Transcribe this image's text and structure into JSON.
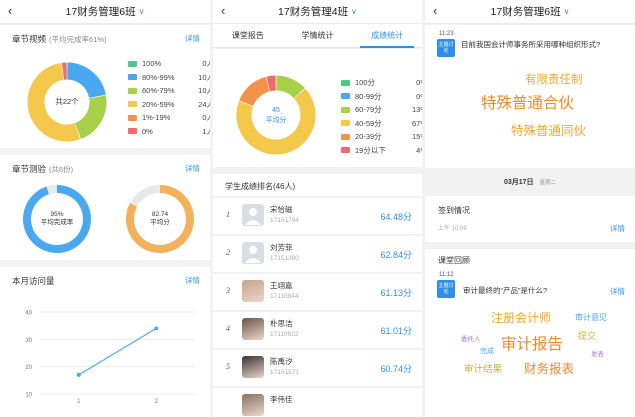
{
  "panel1": {
    "title": "17财务管理6班",
    "video": {
      "title": "章节视频",
      "subtitle": "(平均完成率61%)",
      "detail": "详情",
      "donut_center": "共22个",
      "legend": [
        {
          "label": "100%",
          "count": "0人",
          "color": "#4cc98a",
          "value": 0
        },
        {
          "label": "80%-99%",
          "count": "10人",
          "color": "#4aa8f0",
          "value": 10
        },
        {
          "label": "60%-79%",
          "count": "10人",
          "color": "#a9d04a",
          "value": 10
        },
        {
          "label": "20%-59%",
          "count": "24人",
          "color": "#f3c84b",
          "value": 24
        },
        {
          "label": "1%-19%",
          "count": "0人",
          "color": "#f5924a",
          "value": 0
        },
        {
          "label": "0%",
          "count": "1人",
          "color": "#ef6a6a",
          "value": 1
        }
      ]
    },
    "test": {
      "title": "章节测验",
      "subtitle": "(共6份)",
      "detail": "详情",
      "ring1_value": "95%",
      "ring1_label": "平均完成率",
      "ring1_pct": 95,
      "ring2_value": "82.74",
      "ring2_label": "平均分",
      "ring2_pct": 82.74
    },
    "visits": {
      "title": "本月访问量",
      "detail": "详情"
    }
  },
  "panel2": {
    "title": "17财务管理4班",
    "tabs": [
      "课堂报告",
      "学情统计",
      "成绩统计"
    ],
    "donut_center_value": "45",
    "donut_center_label": "平均分",
    "legend": [
      {
        "label": "100分",
        "pct": "0%",
        "color": "#4cc98a",
        "value": 0
      },
      {
        "label": "80-99分",
        "pct": "0%",
        "color": "#4aa8f0",
        "value": 0
      },
      {
        "label": "60-79分",
        "pct": "13%",
        "color": "#a9d04a",
        "value": 13
      },
      {
        "label": "40-59分",
        "pct": "67%",
        "color": "#f3c84b",
        "value": 67
      },
      {
        "label": "20-39分",
        "pct": "15%",
        "color": "#f5924a",
        "value": 15
      },
      {
        "label": "19分以下",
        "pct": "4%",
        "color": "#ef6a6a",
        "value": 4
      }
    ],
    "ranking_title": "学生成绩排名(46人)",
    "ranking": [
      {
        "rank": "1",
        "name": "宋恰磁",
        "id": "17151794",
        "score": "64.48分",
        "avatar": "placeholder"
      },
      {
        "rank": "2",
        "name": "刘芳菲",
        "id": "17151380",
        "score": "62.84分",
        "avatar": "placeholder"
      },
      {
        "rank": "3",
        "name": "王翊嘉",
        "id": "17110844",
        "score": "61.13分",
        "avatar": "photo"
      },
      {
        "rank": "4",
        "name": "朴思洁",
        "id": "17110922",
        "score": "61.01分",
        "avatar": "photo"
      },
      {
        "rank": "5",
        "name": "陈禹汐",
        "id": "17151571",
        "score": "60.74分",
        "avatar": "photo"
      },
      {
        "rank": "",
        "name": "李伟佳",
        "id": "",
        "score": "",
        "avatar": "photo"
      }
    ]
  },
  "panel3": {
    "title": "17财务管理6班",
    "q1": {
      "time": "11:23",
      "badge": "主题讨论",
      "text": "目前我国会计师事务所采用哪种组织形式?",
      "words": [
        {
          "text": "有限责任制",
          "color": "#f5a623"
        },
        {
          "text": "特殊普通合伙",
          "color": "#f08a24"
        },
        {
          "text": "特殊普通同伙",
          "color": "#f5a623"
        }
      ]
    },
    "date": "03月17日",
    "weekday": "星期二",
    "signin": {
      "title": "签到情况",
      "time": "上午 10:09",
      "detail": "详情"
    },
    "review": {
      "title": "课堂回顾",
      "time": "11:12",
      "badge": "主题讨论",
      "text": "审计最终的“产品”是什么?",
      "detail": "详情",
      "words": [
        {
          "text": "注册会计师",
          "color": "#f5a623"
        },
        {
          "text": "审计意见",
          "color": "#4aa8f0"
        },
        {
          "text": "委托人",
          "color": "#9b7fd6"
        },
        {
          "text": "审计报告",
          "color": "#f08a24"
        },
        {
          "text": "提交",
          "color": "#c8b23a"
        },
        {
          "text": "完成",
          "color": "#4aa8f0"
        },
        {
          "text": "发表",
          "color": "#9b7fd6"
        },
        {
          "text": "审计结果",
          "color": "#c8b23a"
        },
        {
          "text": "财务报表",
          "color": "#f08a24"
        }
      ]
    },
    "q1_detail": "详情"
  },
  "chart_data": [
    {
      "type": "pie",
      "title": "章节视频",
      "categories": [
        "100%",
        "80%-99%",
        "60%-79%",
        "20%-59%",
        "1%-19%",
        "0%"
      ],
      "values": [
        0,
        10,
        10,
        24,
        0,
        1
      ]
    },
    {
      "type": "line",
      "title": "本月访问量",
      "x": [
        1,
        2
      ],
      "series": [
        {
          "values": [
            17,
            34
          ]
        }
      ],
      "ylim": [
        10,
        40
      ],
      "yticks": [
        10,
        20,
        30,
        40
      ],
      "xticks": [
        1,
        2
      ],
      "grid": true
    },
    {
      "type": "pie",
      "title": "成绩统计",
      "categories": [
        "100分",
        "80-99分",
        "60-79分",
        "40-59分",
        "20-39分",
        "19分以下"
      ],
      "values": [
        0,
        0,
        13,
        67,
        15,
        4
      ]
    }
  ]
}
